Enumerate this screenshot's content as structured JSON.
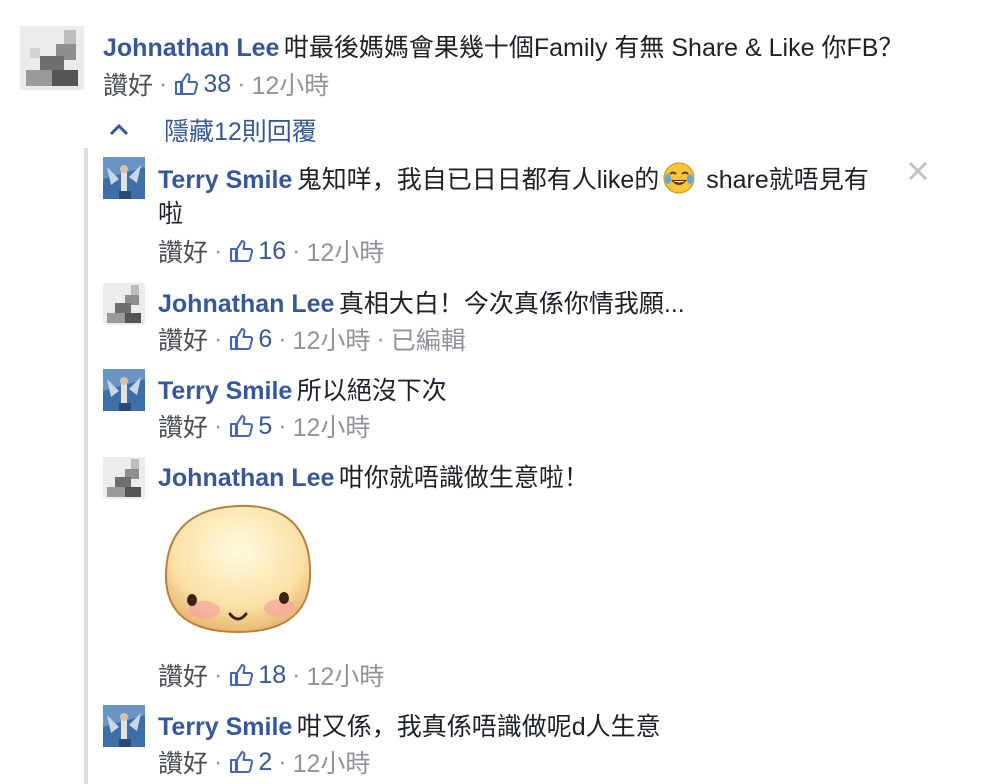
{
  "comments": [
    {
      "author": "Johnathan Lee",
      "text": "咁最後媽媽會果幾十個Family 有無 Share & Like 你FB？",
      "like_label": "讚好",
      "likes": "38",
      "time": "12小時"
    }
  ],
  "replies_toggle": {
    "label": "隱藏12則回覆"
  },
  "replies": [
    {
      "author": "Terry Smile",
      "text_before_emoji": "鬼知咩，我自已日日都有人like的",
      "text_after_emoji": " share就唔見有",
      "text_line2": "啦",
      "like_label": "讚好",
      "likes": "16",
      "time": "12小時"
    },
    {
      "author": "Johnathan Lee",
      "text": "真相大白！今次真係你情我願...",
      "like_label": "讚好",
      "likes": "6",
      "time": "12小時",
      "edited": "已編輯"
    },
    {
      "author": "Terry Smile",
      "text": "所以絕沒下次",
      "like_label": "讚好",
      "likes": "5",
      "time": "12小時"
    },
    {
      "author": "Johnathan Lee",
      "text": "咁你就唔識做生意啦！",
      "like_label": "讚好",
      "likes": "18",
      "time": "12小時"
    },
    {
      "author": "Terry Smile",
      "text": "咁又係，我真係唔識做呢d人生意",
      "like_label": "讚好",
      "likes": "2",
      "time": "12小時"
    }
  ],
  "colors": {
    "name": "#365899",
    "meta": "#90949c",
    "thread_line": "#dddfe2"
  },
  "icons": [
    "like-icon",
    "chevron-up-icon",
    "close-icon",
    "laughing-emoji",
    "blob-sticker"
  ]
}
